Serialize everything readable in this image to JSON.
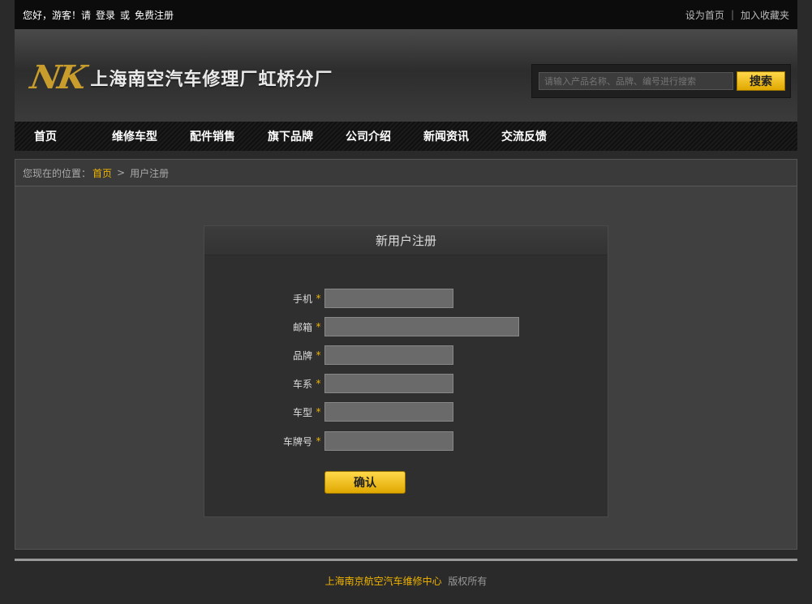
{
  "topbar": {
    "greeting": "您好，游客！请",
    "login": "登录",
    "or": "或",
    "register": "免费注册",
    "set_home": "设为首页",
    "sep": "|",
    "favorite": "加入收藏夹"
  },
  "header": {
    "logo_mark": "NK",
    "site_name": "上海南空汽车修理厂虹桥分厂",
    "search_placeholder": "请输入产品名称、品牌、编号进行搜索",
    "search_button": "搜索"
  },
  "nav": {
    "items": [
      "首页",
      "维修车型",
      "配件销售",
      "旗下品牌",
      "公司介绍",
      "新闻资讯",
      "交流反馈"
    ]
  },
  "breadcrumb": {
    "prefix": "您现在的位置：",
    "home": "首页",
    "sep": ">",
    "current": "用户注册"
  },
  "form": {
    "title": "新用户注册",
    "required_mark": "*",
    "fields": [
      {
        "label": "手机",
        "value": ""
      },
      {
        "label": "邮箱",
        "value": ""
      },
      {
        "label": "品牌",
        "value": ""
      },
      {
        "label": "车系",
        "value": ""
      },
      {
        "label": "车型",
        "value": ""
      },
      {
        "label": "车牌号",
        "value": ""
      }
    ],
    "confirm": "确认"
  },
  "footer": {
    "company": "上海南京航空汽车维修中心",
    "rights": "版权所有"
  },
  "colors": {
    "accent": "#f0b400",
    "background": "#2a2a2a"
  }
}
